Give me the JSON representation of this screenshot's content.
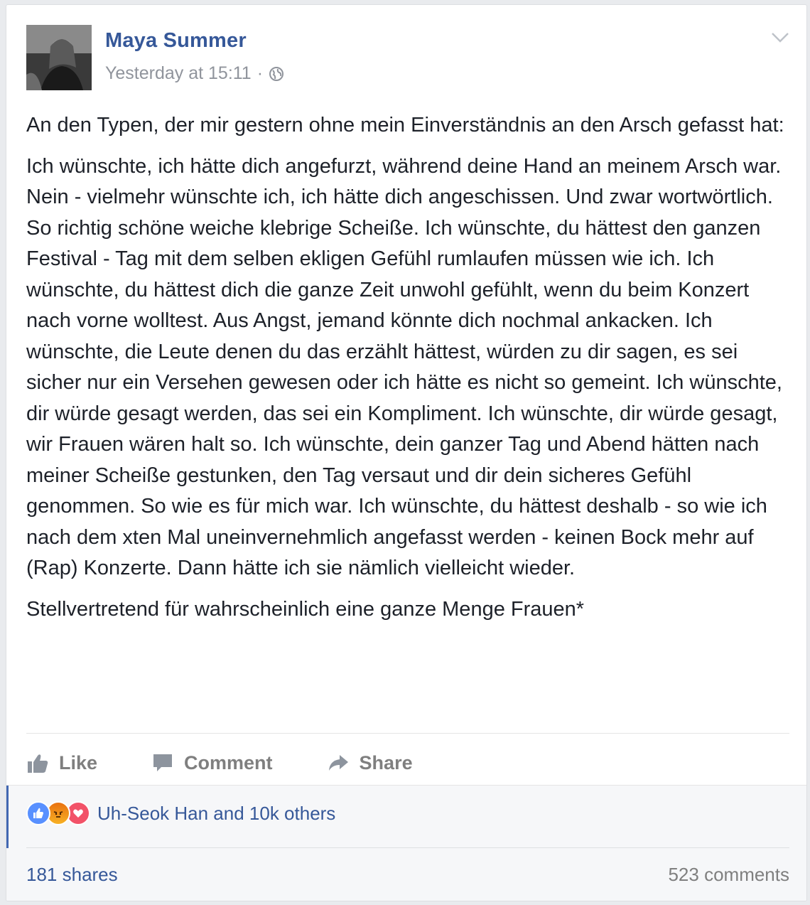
{
  "post": {
    "author": "Maya Summer",
    "timestamp": "Yesterday at 15:11",
    "separator": "·",
    "privacy_icon": "globe-icon",
    "menu_icon": "chevron-down-icon",
    "paragraphs": [
      "An den Typen, der mir gestern ohne mein Einverständnis an den Arsch gefasst hat:",
      "Ich wünschte, ich hätte dich angefurzt, während deine Hand an meinem Arsch war. Nein - vielmehr wünschte ich, ich hätte dich angeschissen. Und zwar wortwörtlich. So richtig schöne weiche klebrige Scheiße. Ich wünschte, du hättest den ganzen Festival - Tag mit dem selben ekligen Gefühl rumlaufen müssen wie ich. Ich wünschte, du hättest dich die ganze Zeit unwohl gefühlt, wenn du beim Konzert nach vorne wolltest. Aus Angst, jemand könnte dich nochmal ankacken. Ich wünschte, die Leute denen du das erzählt hättest, würden zu dir sagen, es sei sicher nur ein Versehen gewesen oder ich hätte es nicht so gemeint. Ich wünschte, dir würde gesagt werden, das sei ein Kompliment. Ich wünschte, dir würde gesagt, wir Frauen wären halt so. Ich wünschte, dein ganzer Tag und Abend hätten nach meiner Scheiße gestunken, den Tag versaut und dir dein sicheres Gefühl genommen. So wie es für mich war. Ich wünschte, du hättest deshalb - so wie ich nach dem xten Mal uneinvernehmlich angefasst werden - keinen Bock mehr auf (Rap) Konzerte. Dann hätte ich sie nämlich vielleicht wieder.",
      "Stellvertretend für wahrscheinlich eine ganze Menge Frauen*"
    ]
  },
  "actions": {
    "like": "Like",
    "comment": "Comment",
    "share": "Share",
    "like_icon": "thumbs-up-icon",
    "comment_icon": "comment-bubble-icon",
    "share_icon": "share-arrow-icon"
  },
  "reactions": {
    "icons": [
      "like-reaction-icon",
      "angry-reaction-icon",
      "love-reaction-icon"
    ],
    "summary": "Uh-Seok Han and 10k others"
  },
  "stats": {
    "shares": "181 shares",
    "comments": "523 comments"
  },
  "colors": {
    "link": "#365899",
    "muted": "#90949c",
    "text": "#1d2129",
    "accent": "#4267b2",
    "like_blue": "#5890ff",
    "love_red": "#f25268",
    "angry_orange": "#e9710f"
  }
}
